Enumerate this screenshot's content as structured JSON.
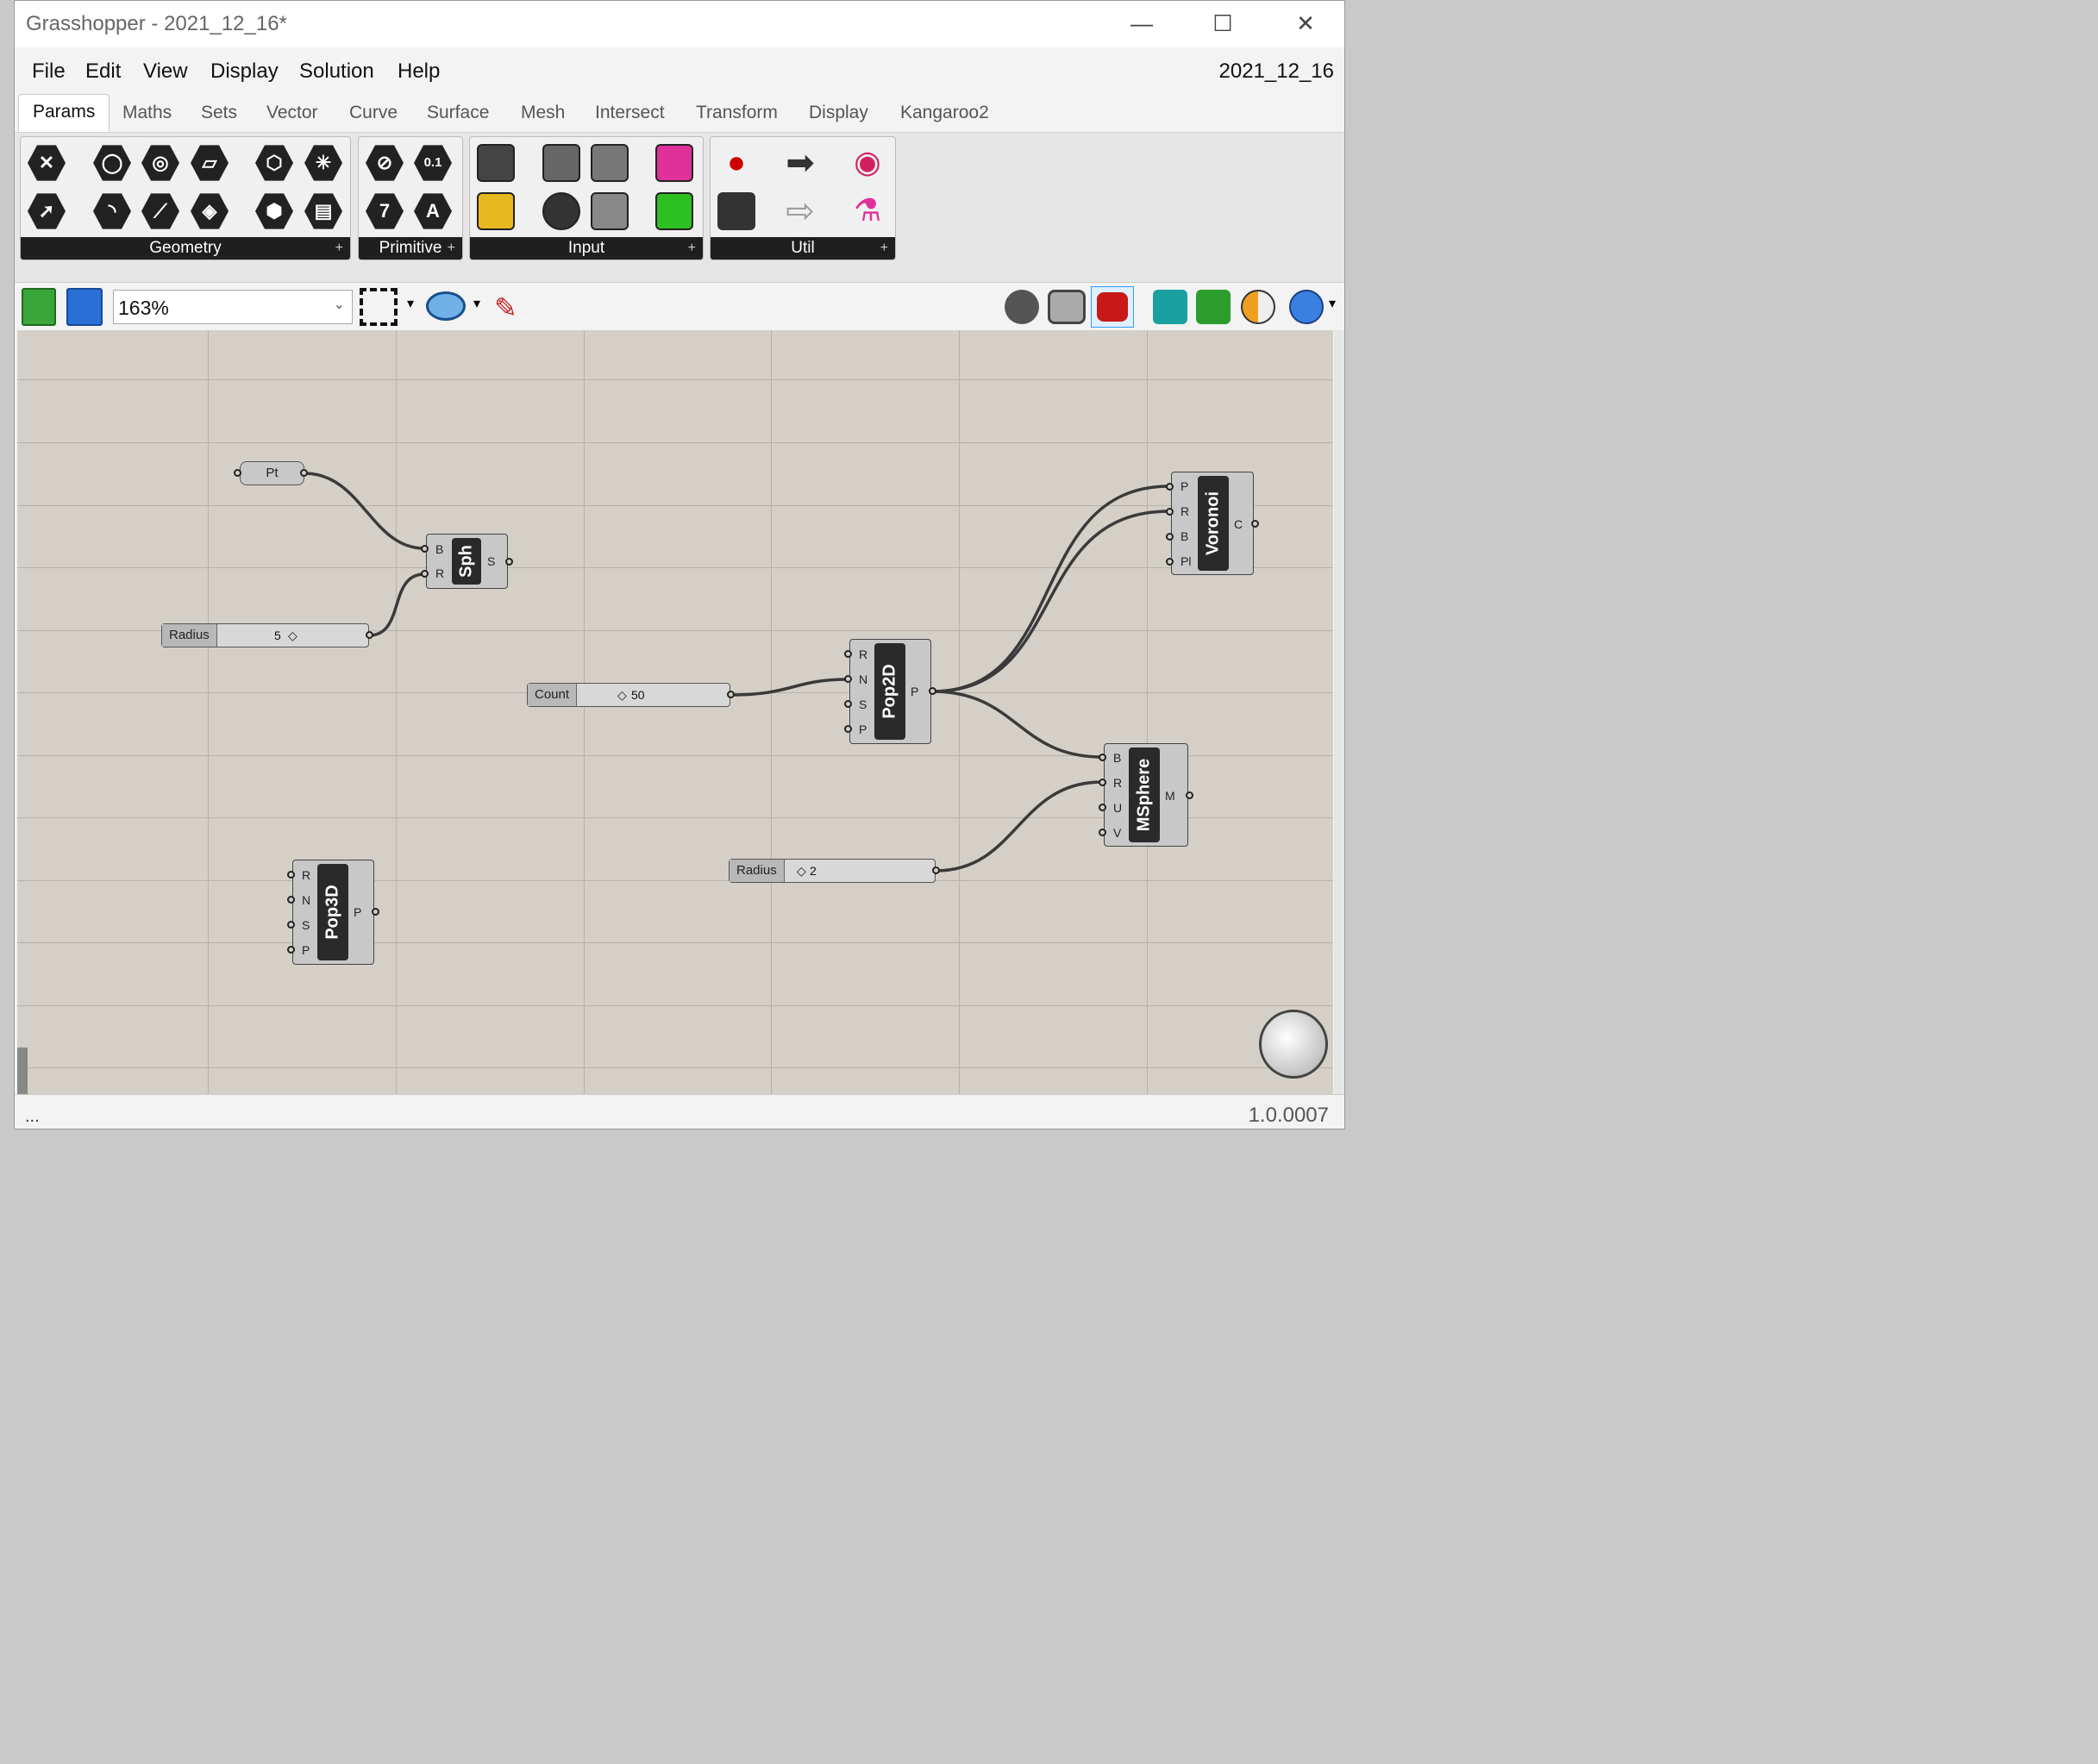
{
  "window": {
    "title": "Grasshopper - 2021_12_16*",
    "minimize": "—",
    "maximize": "☐",
    "close": "✕"
  },
  "menu": [
    "File",
    "Edit",
    "View",
    "Display",
    "Solution",
    "Help"
  ],
  "doc_name": "2021_12_16",
  "tabs": [
    "Params",
    "Maths",
    "Sets",
    "Vector",
    "Curve",
    "Surface",
    "Mesh",
    "Intersect",
    "Transform",
    "Display",
    "Kangaroo2"
  ],
  "active_tab": "Params",
  "ribbon_panels": {
    "geometry": "Geometry",
    "primitive": "Primitive",
    "input": "Input",
    "util": "Util",
    "expand": "+"
  },
  "primitive_icons": {
    "number": "0.1",
    "integer": "7",
    "text": "A"
  },
  "canvas_toolbar": {
    "zoom": "163%",
    "zoom_arrow": "⌄",
    "dropdown": "▾"
  },
  "nodes": {
    "pt": {
      "label": "Pt"
    },
    "sph": {
      "name": "Sph",
      "inputs": [
        "B",
        "R"
      ],
      "outputs": [
        "S"
      ]
    },
    "radius1": {
      "name": "Radius",
      "value": "5"
    },
    "count": {
      "name": "Count",
      "value": "50"
    },
    "pop2d": {
      "name": "Pop2D",
      "inputs": [
        "R",
        "N",
        "S",
        "P"
      ],
      "outputs": [
        "P"
      ]
    },
    "voronoi": {
      "name": "Voronoi",
      "inputs": [
        "P",
        "R",
        "B",
        "Pl"
      ],
      "outputs": [
        "C"
      ]
    },
    "msphere": {
      "name": "MSphere",
      "inputs": [
        "B",
        "R",
        "U",
        "V"
      ],
      "outputs": [
        "M"
      ]
    },
    "radius2": {
      "name": "Radius",
      "value": "2"
    },
    "pop3d": {
      "name": "Pop3D",
      "inputs": [
        "R",
        "N",
        "S",
        "P"
      ],
      "outputs": [
        "P"
      ]
    }
  },
  "slider_marker": "◇",
  "status": {
    "left": "...",
    "version": "1.0.0007"
  },
  "colors": {
    "canvas": "#d4d0c8",
    "grid": "#b7b3ab",
    "wire": "#3a3a3a"
  }
}
